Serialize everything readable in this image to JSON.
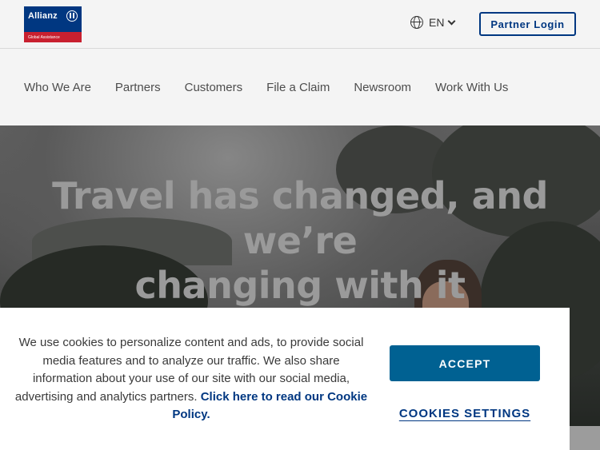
{
  "header": {
    "logo": {
      "name": "Allianz",
      "tagline": "Global Assistance",
      "icon": "allianz-eagle-mark-icon",
      "colors": {
        "primary": "#003781",
        "tagline_bg": "#c8202f"
      }
    },
    "language": {
      "icon": "globe-icon",
      "value": "EN",
      "dropdown_icon": "chevron-down-icon"
    },
    "partner_login_label": "Partner Login"
  },
  "nav": {
    "items": [
      {
        "label": "Who We Are"
      },
      {
        "label": "Partners"
      },
      {
        "label": "Customers"
      },
      {
        "label": "File a Claim"
      },
      {
        "label": "Newsroom"
      },
      {
        "label": "Work With Us"
      }
    ]
  },
  "hero": {
    "title_line1": "Travel has changed, and we’re",
    "title_line2": "changing with it"
  },
  "cookie_banner": {
    "text": "We use cookies to personalize content and ads, to provide social media features and to analyze our traffic. We also share information about your use of our site with our social media, advertising and analytics partners.",
    "link_text": "Click here to read our Cookie Policy.",
    "accept_label": "ACCEPT",
    "settings_label": "COOKIES SETTINGS",
    "colors": {
      "accept_bg": "#006192",
      "link": "#003781"
    }
  }
}
